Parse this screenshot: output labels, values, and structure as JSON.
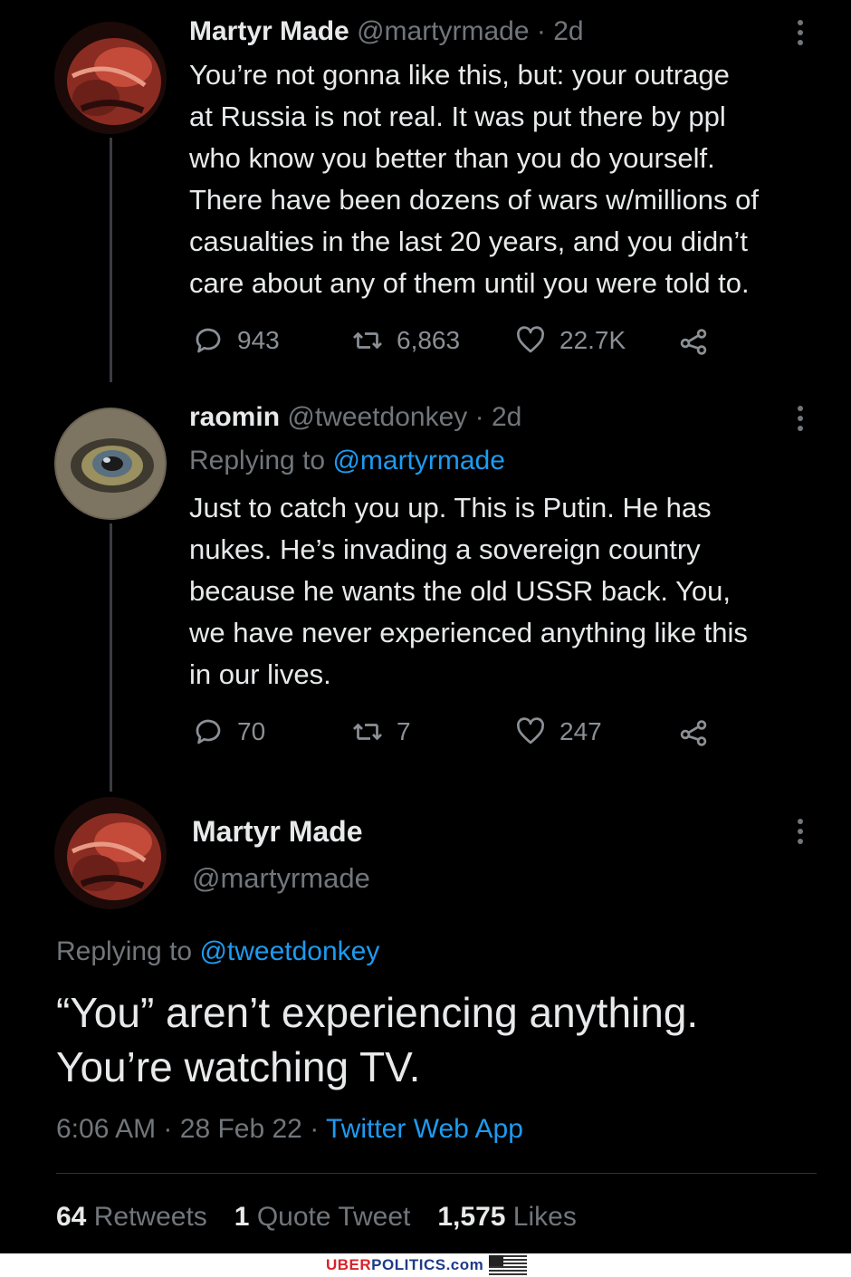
{
  "tweet1": {
    "name": "Martyr Made",
    "handle": "@martyrmade",
    "time": "· 2d",
    "text": "You’re not gonna like this, but: your outrage\nat Russia is not real. It was put there by ppl\nwho know you better than you do yourself.\nThere have been dozens of wars w/millions of\ncasualties in the last 20 years, and you didn’t\ncare about any of them until you were told to.",
    "replies": "943",
    "retweets": "6,863",
    "likes": "22.7K",
    "icons": {
      "reply": "reply-icon",
      "retweet": "retweet-icon",
      "like": "heart-icon",
      "share": "share-icon",
      "more": "more-icon"
    }
  },
  "tweet2": {
    "name": "raomin",
    "handle": "@tweetdonkey",
    "time": "· 2d",
    "replying_prefix": "Replying to",
    "replying_handle": "@martyrmade",
    "text": "Just to catch you up. This is Putin. He has\nnukes. He’s invading a sovereign country\nbecause he wants the old USSR back. You,\nwe have never experienced anything like this\nin our lives.",
    "replies": "70",
    "retweets": "7",
    "likes": "247"
  },
  "main": {
    "name": "Martyr Made",
    "handle": "@martyrmade",
    "replying_prefix": "Replying to",
    "replying_handle": "@tweetdonkey",
    "text": "“You” aren’t experiencing anything.\nYou’re watching TV.",
    "time": "6:06 AM",
    "date": "28 Feb 22",
    "app": "Twitter Web App",
    "retweets_count": "64",
    "retweets_label": "Retweets",
    "quotes_count": "1",
    "quotes_label": "Quote Tweet",
    "likes_count": "1,575",
    "likes_label": "Likes"
  },
  "watermark": {
    "part1": "UBER",
    "part2": "POLITICS.com"
  },
  "colors": {
    "background": "#000000",
    "text": "#e7e9ea",
    "secondary": "#71767b",
    "link": "#1d9bf0",
    "watermark_red": "#d8232a",
    "watermark_blue": "#1e3a8a"
  }
}
